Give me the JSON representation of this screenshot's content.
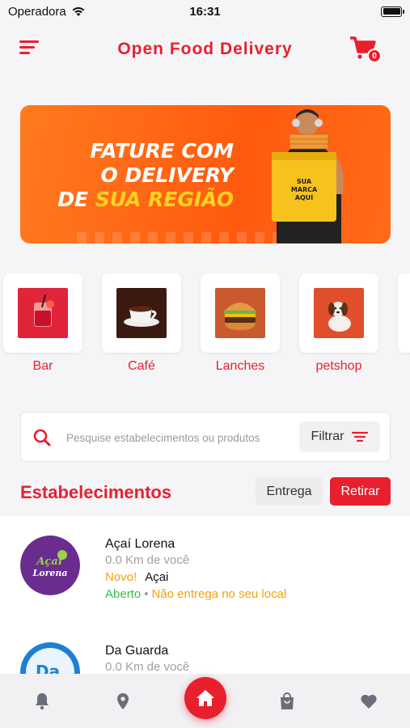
{
  "status_bar": {
    "carrier": "Operadora",
    "time": "16:31"
  },
  "header": {
    "title": "Open Food Delivery",
    "cart_count": "0"
  },
  "banner": {
    "line1": "FATURE COM",
    "line2": "O DELIVERY",
    "line3_prefix": "DE ",
    "line3_highlight": "SUA REGIÃO",
    "bag_text_1": "SUA",
    "bag_text_2": "MARCA",
    "bag_text_3": "AQUI"
  },
  "categories": [
    {
      "label": "Bar",
      "icon": "drink-icon"
    },
    {
      "label": "Café",
      "icon": "coffee-icon"
    },
    {
      "label": "Lanches",
      "icon": "burger-icon"
    },
    {
      "label": "petshop",
      "icon": "dog-icon"
    }
  ],
  "search": {
    "placeholder": "Pesquise estabelecimentos ou produtos",
    "filter_label": "Filtrar"
  },
  "section": {
    "title": "Estabelecimentos",
    "entrega_label": "Entrega",
    "retirar_label": "Retirar"
  },
  "stores": [
    {
      "name": "Açaí Lorena",
      "distance": "0.0 Km de você",
      "badge": "Novo!",
      "category": "Açai",
      "status": "Aberto",
      "delivery_note": "Não entrega no seu local",
      "logo_text_1": "Açaí",
      "logo_text_2": "Lorena"
    },
    {
      "name": "Da Guarda",
      "distance": "0.0 Km de você",
      "logo_text": "Da"
    }
  ],
  "colors": {
    "accent": "#e8202e",
    "banner_orange": "#ff5a10",
    "highlight_yellow": "#ffd21f",
    "open_green": "#3dbb4e",
    "warning_orange": "#f0a20e"
  },
  "bottom_nav": [
    "bell-icon",
    "location-icon",
    "home-icon",
    "bag-icon",
    "heart-icon"
  ]
}
